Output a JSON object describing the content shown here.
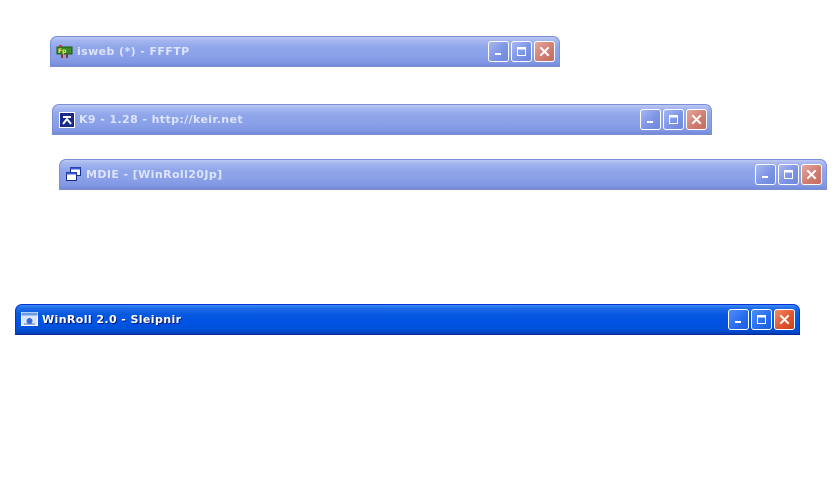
{
  "windows": [
    {
      "title": "isweb (*) - FFFTP",
      "icon": "ffftp-icon",
      "state": "inactive"
    },
    {
      "title": "K9 - 1.28 - http://keir.net",
      "icon": "k9-icon",
      "state": "inactive"
    },
    {
      "title": "MDIE - [WinRoll20Jp]",
      "icon": "mdie-icon",
      "state": "inactive"
    },
    {
      "title": "WinRoll 2.0 - Sleipnir",
      "icon": "sleipnir-icon",
      "state": "active"
    }
  ],
  "colors": {
    "inactive_title_top": "#bdc9f3",
    "inactive_title_bottom": "#7389d8",
    "active_title_top": "#3d8df5",
    "active_title_bottom": "#003cb8",
    "close_button_active": "#e1552f"
  }
}
